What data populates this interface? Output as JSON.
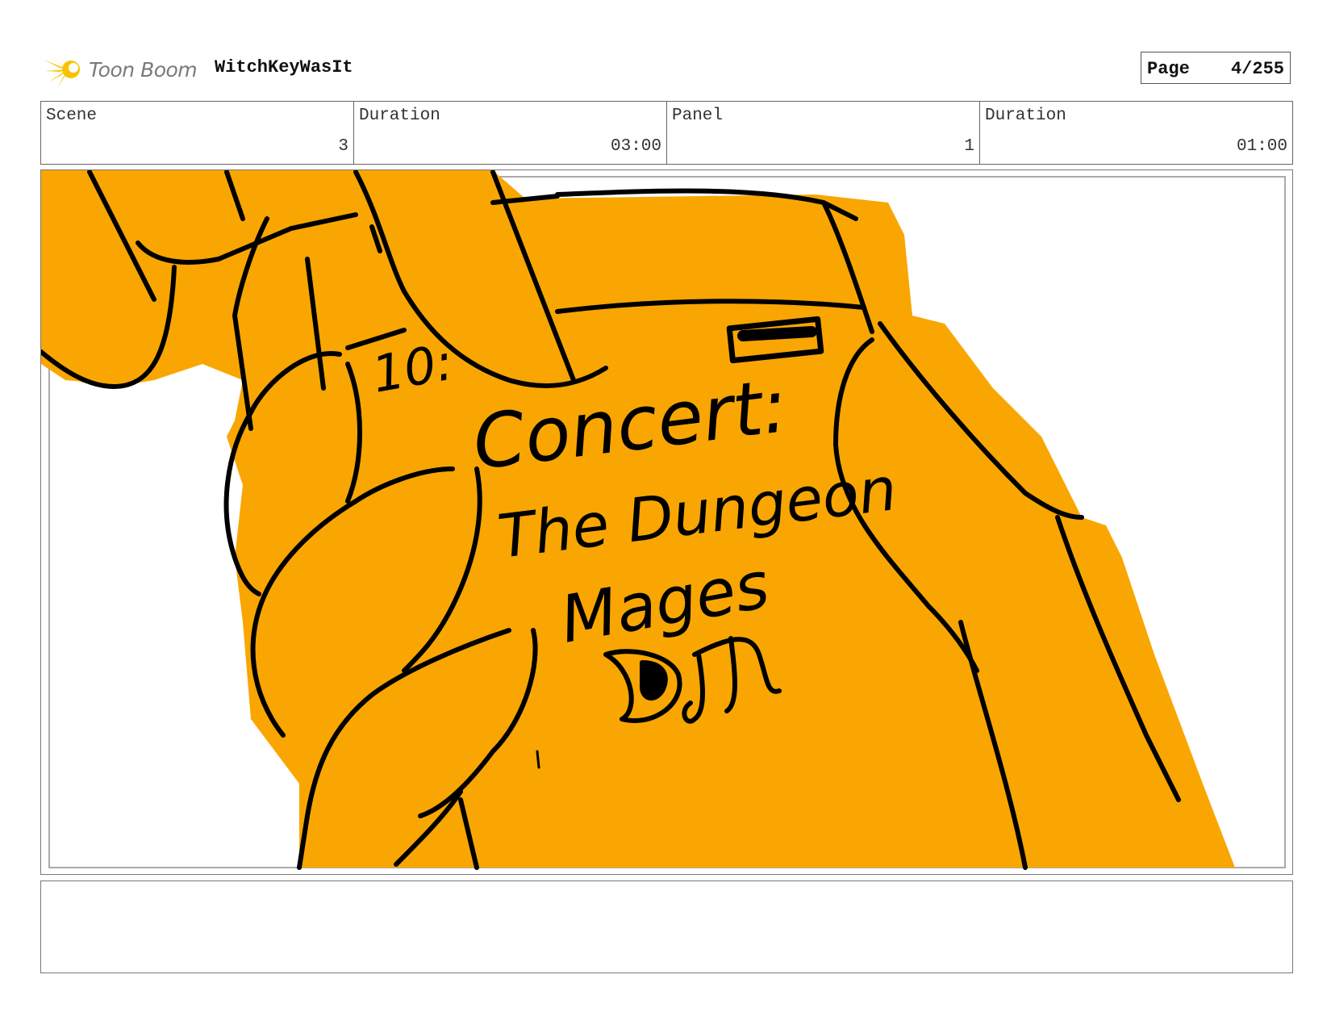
{
  "header": {
    "logo_text": "Toon Boom",
    "project_title": "WitchKeyWasIt",
    "page_label": "Page",
    "page_value": "4/255"
  },
  "info": {
    "scene_label": "Scene",
    "scene_value": "3",
    "scene_duration_label": "Duration",
    "scene_duration_value": "03:00",
    "panel_label": "Panel",
    "panel_value": "1",
    "panel_duration_label": "Duration",
    "panel_duration_value": "01:00"
  },
  "panel": {
    "phone_time": "10:",
    "handwritten_line1": "Concert:",
    "handwritten_line2": "The Dungeon",
    "handwritten_line3": "Mages",
    "fill_color": "#F9A602",
    "ink_color": "#000000"
  },
  "notes": {
    "text": ""
  }
}
